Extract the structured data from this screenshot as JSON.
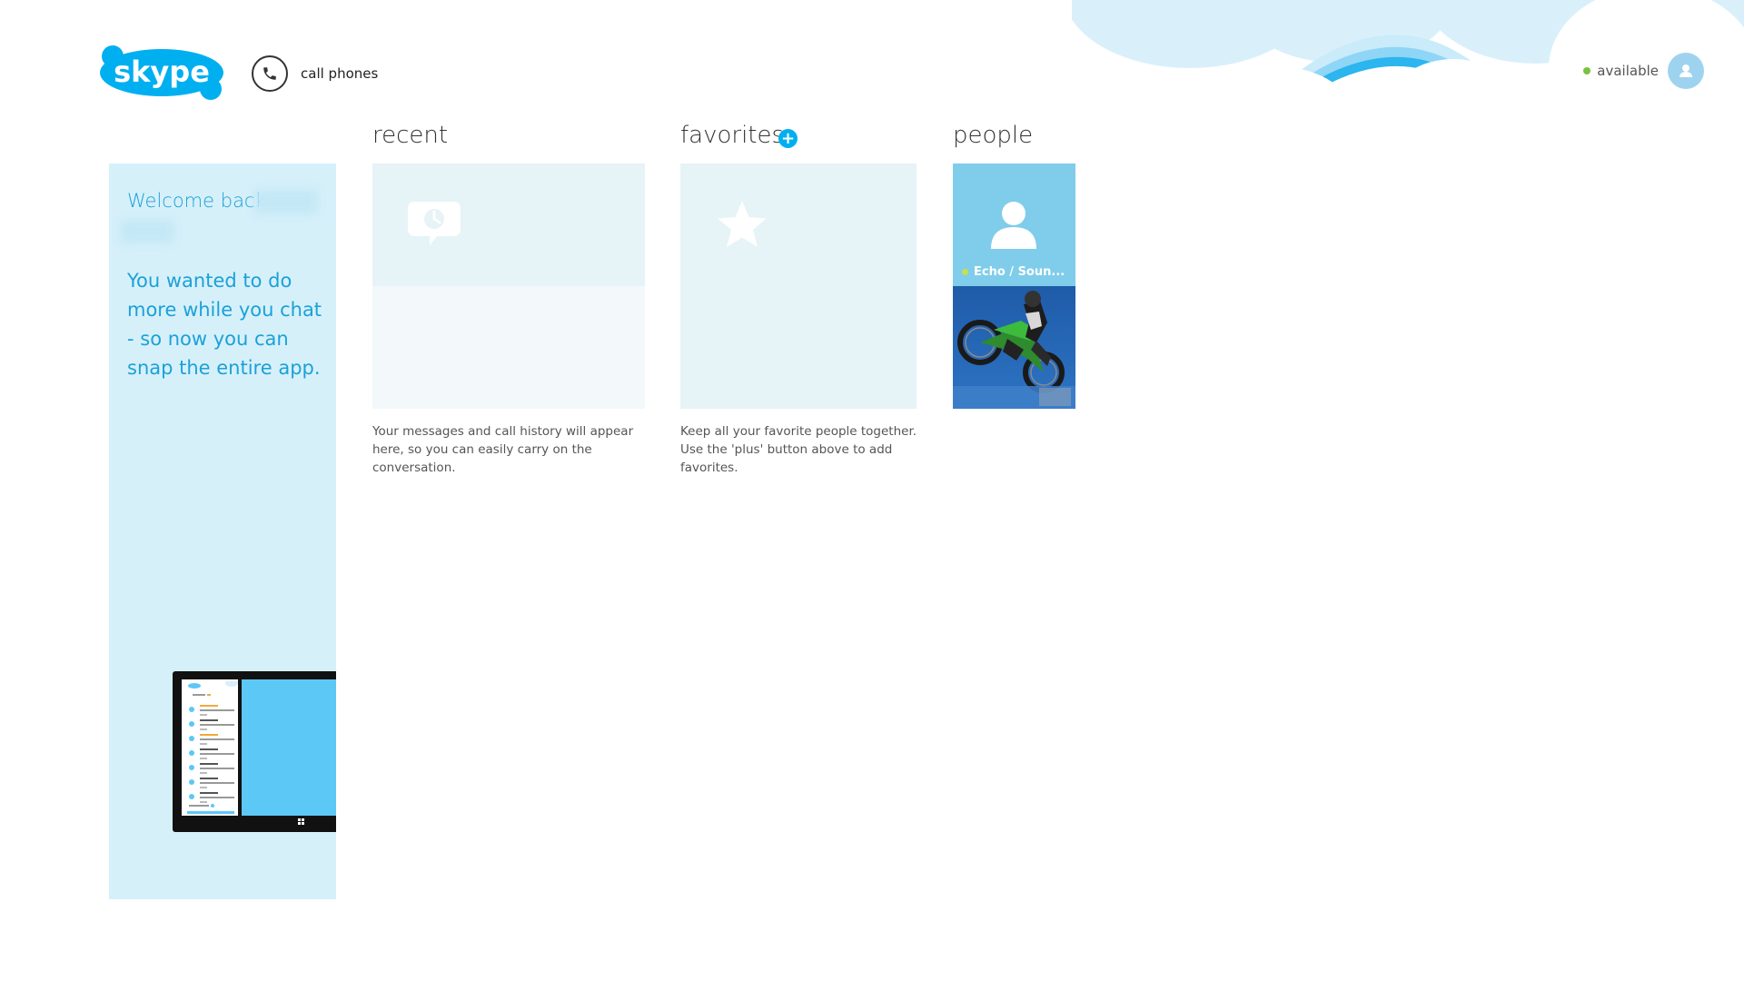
{
  "header": {
    "logo_text": "skype",
    "call_phones_label": "call phones",
    "status_label": "available",
    "status_color": "#7ac142"
  },
  "welcome": {
    "title": "Welcome back",
    "body": "You wanted to do more while you chat - so now you can snap the entire app."
  },
  "sections": {
    "recent": {
      "title": "recent",
      "icon": "recent-clock-icon",
      "description": "Your messages and call history will appear here, so you can easily carry on the conversation."
    },
    "favorites": {
      "title": "favorites",
      "icon": "star-icon",
      "add_icon": "plus-icon",
      "description": "Keep all your favorite people together. Use the 'plus' button above to add favorites."
    },
    "people": {
      "title": "people",
      "contacts": [
        {
          "name": "Echo / Soun...",
          "status_color": "#c6e14a"
        }
      ]
    }
  },
  "colors": {
    "accent": "#00aff0",
    "welcome_text": "#1ba1d8",
    "welcome_bg": "#d6f0fa"
  }
}
